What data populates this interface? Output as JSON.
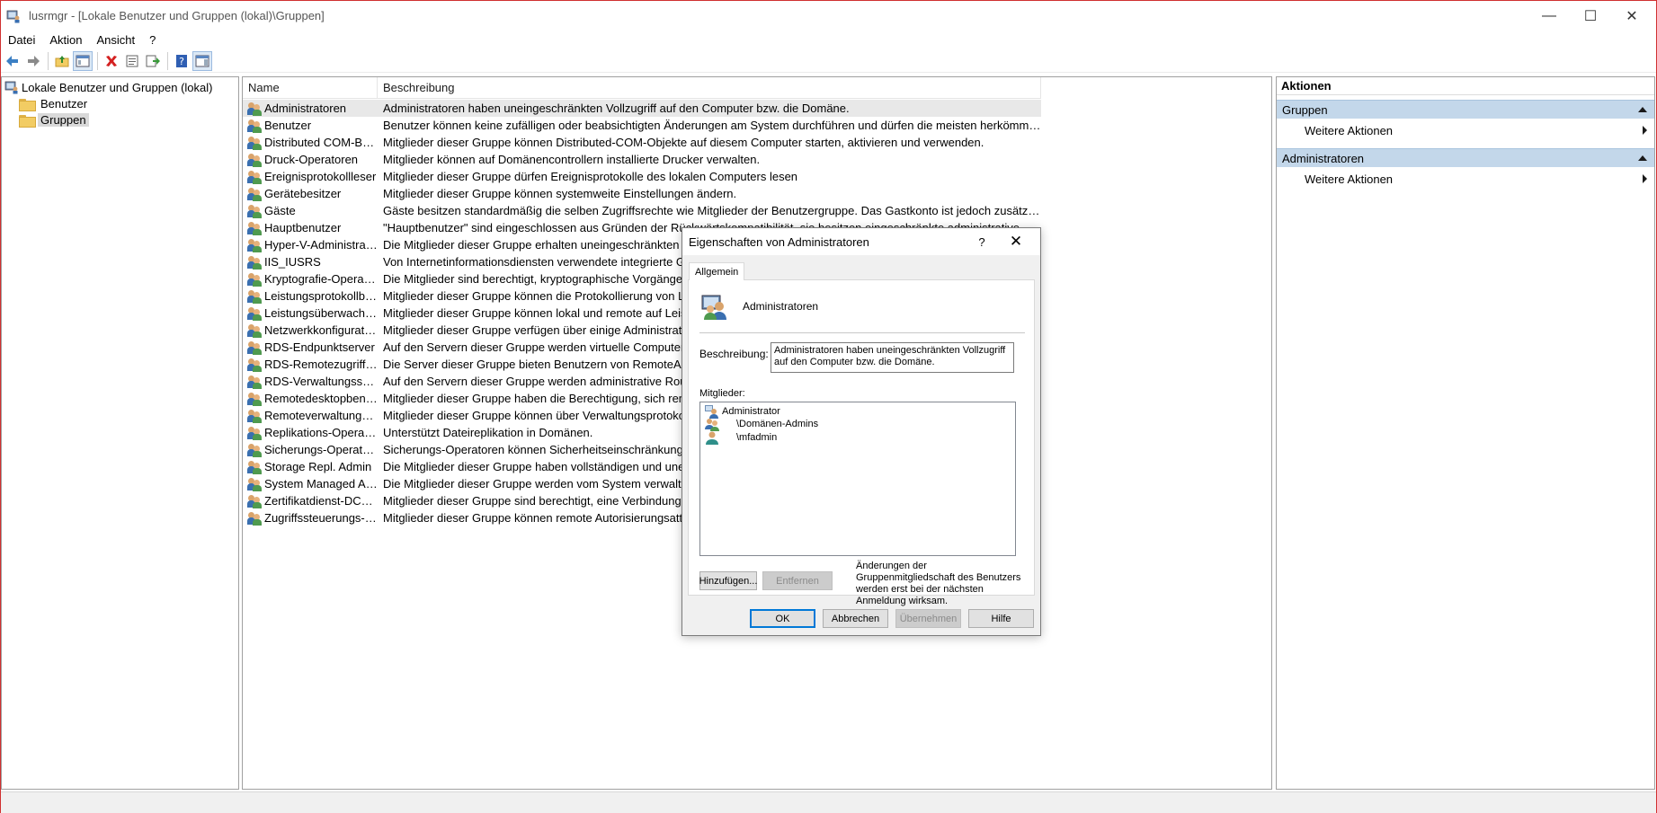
{
  "window": {
    "title": "lusrmgr - [Lokale Benutzer und Gruppen (lokal)\\Gruppen]",
    "controls": {
      "minimize": "—",
      "maximize": "☐",
      "close": "✕"
    }
  },
  "menu": [
    {
      "label": "Datei"
    },
    {
      "label": "Aktion"
    },
    {
      "label": "Ansicht"
    },
    {
      "label": "?"
    }
  ],
  "toolbar": {
    "icons": [
      "back-arrow-icon",
      "forward-arrow-icon",
      "up-folder-icon",
      "show-hide-tree-icon",
      "delete-icon",
      "properties-icon",
      "export-list-icon",
      "help-icon",
      "show-hide-action-pane-icon"
    ]
  },
  "tree": {
    "root": "Lokale Benutzer und Gruppen (lokal)",
    "children": [
      {
        "label": "Benutzer"
      },
      {
        "label": "Gruppen"
      }
    ]
  },
  "list": {
    "headers": {
      "name": "Name",
      "description": "Beschreibung"
    },
    "rows": [
      {
        "name": "Administratoren",
        "description": "Administratoren haben uneingeschränkten Vollzugriff auf den Computer bzw. die Domäne."
      },
      {
        "name": "Benutzer",
        "description": "Benutzer können keine zufälligen oder beabsichtigten Änderungen am System durchführen und dürfen die meisten herkömmlichen An..."
      },
      {
        "name": "Distributed COM-Ben...",
        "description": "Mitglieder dieser Gruppe können Distributed-COM-Objekte auf diesem Computer starten, aktivieren und verwenden."
      },
      {
        "name": "Druck-Operatoren",
        "description": "Mitglieder können auf Domänencontrollern installierte Drucker verwalten."
      },
      {
        "name": "Ereignisprotokollleser",
        "description": "Mitglieder dieser Gruppe dürfen Ereignisprotokolle des lokalen Computers lesen"
      },
      {
        "name": "Gerätebesitzer",
        "description": "Mitglieder dieser Gruppe können systemweite Einstellungen ändern."
      },
      {
        "name": "Gäste",
        "description": "Gäste besitzen standardmäßig die selben Zugriffsrechte wie Mitglieder der Benutzergruppe. Das Gastkonto ist jedoch zusätzlich eingesc..."
      },
      {
        "name": "Hauptbenutzer",
        "description": "\"Hauptbenutzer\" sind eingeschlossen aus Gründen der Rückwärtskompatibilität, sie besitzen eingeschränkte administrative Rechte."
      },
      {
        "name": "Hyper-V-Administrat...",
        "description": "Die Mitglieder dieser Gruppe erhalten uneingeschränkten Zugri"
      },
      {
        "name": "IIS_IUSRS",
        "description": "Von Internetinformationsdiensten verwendete integrierte Grupp"
      },
      {
        "name": "Kryptografie-Operator...",
        "description": "Die Mitglieder sind berechtigt, kryptographische Vorgänge durc"
      },
      {
        "name": "Leistungsprotokollbe...",
        "description": "Mitglieder dieser Gruppe können die Protokollierung von Leistu"
      },
      {
        "name": "Leistungsüberwachun...",
        "description": "Mitglieder dieser Gruppe können lokal und remote auf Leistung"
      },
      {
        "name": "Netzwerkkonfiguratio...",
        "description": "Mitglieder dieser Gruppe verfügen über einige Administratorrec"
      },
      {
        "name": "RDS-Endpunktserver",
        "description": "Auf den Servern dieser Gruppe werden virtuelle Computer ausg"
      },
      {
        "name": "RDS-Remotezugriffsse...",
        "description": "Die Server dieser Gruppe bieten Benutzern von RemoteApp-Pro"
      },
      {
        "name": "RDS-Verwaltungsserver",
        "description": "Auf den Servern dieser Gruppe werden administrative Routinea"
      },
      {
        "name": "Remotedesktopbenut...",
        "description": "Mitglieder dieser Gruppe haben die Berechtigung, sich remote"
      },
      {
        "name": "Remoteverwaltungsb...",
        "description": "Mitglieder dieser Gruppe können über Verwaltungsprotokolle a"
      },
      {
        "name": "Replikations-Operator",
        "description": "Unterstützt Dateireplikation in Domänen."
      },
      {
        "name": "Sicherungs-Operatoren",
        "description": "Sicherungs-Operatoren können Sicherheitseinschränkungen le"
      },
      {
        "name": "Storage Repl. Admin",
        "description": "Die Mitglieder dieser Gruppe haben vollständigen und uneinge"
      },
      {
        "name": "System Managed Acc...",
        "description": "Die Mitglieder dieser Gruppe werden vom System verwaltet."
      },
      {
        "name": "Zertifikatdienst-DCO...",
        "description": "Mitglieder dieser Gruppe sind berechtigt, eine Verbindung mit c"
      },
      {
        "name": "Zugriffssteuerungs-U...",
        "description": "Mitglieder dieser Gruppe können remote Autorisierungsattribut"
      }
    ]
  },
  "actions": {
    "title": "Aktionen",
    "groups": [
      {
        "title": "Gruppen",
        "item": "Weitere Aktionen"
      },
      {
        "title": "Administratoren",
        "item": "Weitere Aktionen"
      }
    ]
  },
  "dialog": {
    "title": "Eigenschaften von Administratoren",
    "help": "?",
    "close": "✕",
    "tab": "Allgemein",
    "group_name": "Administratoren",
    "description_label": "Beschreibung:",
    "description_value": "Administratoren haben uneingeschränkten Vollzugriff auf den Computer bzw. die Domäne.",
    "members_label": "Mitglieder:",
    "members": [
      {
        "name": "Administrator",
        "icon": "user-icon"
      },
      {
        "name": "\\Domänen-Admins",
        "icon": "group-icon"
      },
      {
        "name": "\\mfadmin",
        "icon": "user-icon"
      }
    ],
    "add_button": "Hinzufügen...",
    "remove_button": "Entfernen",
    "info_text": "Änderungen der Gruppenmitgliedschaft des Benutzers werden erst bei der nächsten Anmeldung wirksam.",
    "ok_button": "OK",
    "cancel_button": "Abbrechen",
    "apply_button": "Übernehmen",
    "help_button": "Hilfe"
  }
}
